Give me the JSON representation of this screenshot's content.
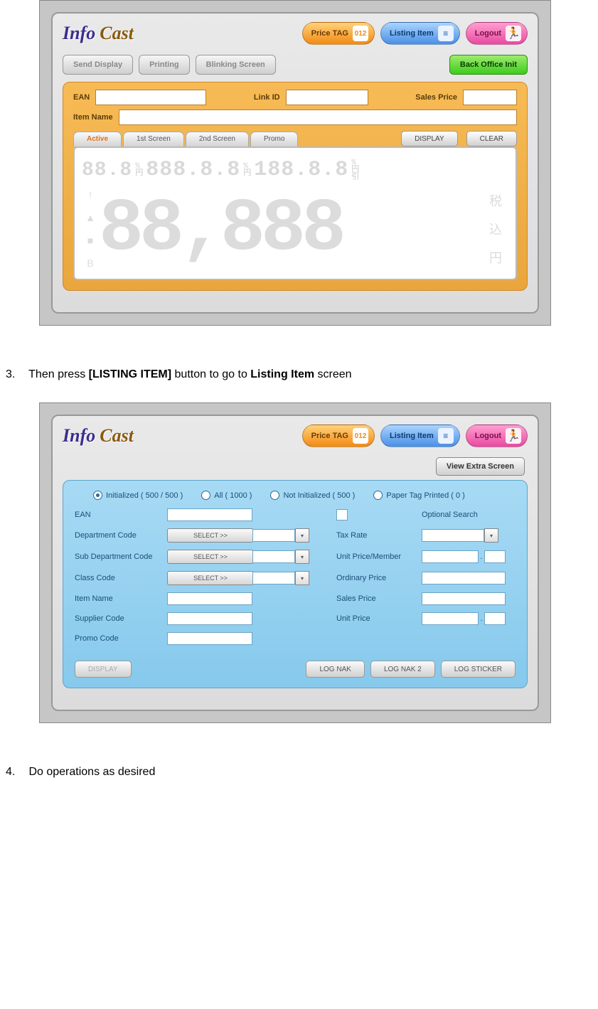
{
  "logo": {
    "part1": "Info",
    "part2": "Cast"
  },
  "nav": {
    "price_tag": "Price TAG",
    "price_tag_num": "012",
    "listing_item": "Listing Item",
    "logout": "Logout"
  },
  "screen1": {
    "toolbar": {
      "send_display": "Send Display",
      "printing": "Printing",
      "blinking": "Blinking Screen",
      "back_office": "Back Office Init"
    },
    "fields": {
      "ean": "EAN",
      "link_id": "Link ID",
      "sales_price": "Sales Price",
      "item_name": "Item Name"
    },
    "tabs": {
      "active": "Active",
      "first": "1st Screen",
      "second": "2nd Screen",
      "promo": "Promo"
    },
    "buttons": {
      "display": "DISPLAY",
      "clear": "CLEAR"
    },
    "lcd": {
      "top_left": "88.8",
      "top_mid": "888.8.8",
      "top_right": "188.8.8",
      "pct": "%",
      "yen": "円",
      "hiki": "引",
      "main_digits": "88,888",
      "side": {
        "ex": "!",
        "tri": "▲",
        "sq": "■",
        "b": "B"
      },
      "right": {
        "zei": "税",
        "komi": "込",
        "en": "円"
      }
    }
  },
  "instructions": {
    "step3_num": "3.",
    "step3_a": "Then press ",
    "step3_b": "[LISTING ITEM]",
    "step3_c": " button to go to ",
    "step3_d": "Listing Item",
    "step3_e": " screen",
    "step4_num": "4.",
    "step4_a": "Do operations as desired"
  },
  "screen2": {
    "view_extra": "View Extra Screen",
    "radios": {
      "initialized": "Initialized  ( 500 / 500 )",
      "all": "All  ( 1000 )",
      "not_init": "Not Initialized  ( 500 )",
      "paper_tag": "Paper Tag Printed  ( 0 )"
    },
    "labels": {
      "ean": "EAN",
      "optional": "Optional Search",
      "dept": "Department Code",
      "select": "SELECT >>",
      "tax": "Tax Rate",
      "subdept": "Sub Department Code",
      "unit_member": "Unit Price/Member",
      "class": "Class Code",
      "ordinary": "Ordinary Price",
      "item_name": "Item Name",
      "sales_price": "Sales Price",
      "supplier": "Supplier Code",
      "unit_price": "Unit Price",
      "promo": "Promo Code",
      "period": "."
    },
    "footer": {
      "display": "DISPLAY",
      "log_nak": "LOG NAK",
      "log_nak2": "LOG NAK 2",
      "log_sticker": "LOG STICKER"
    }
  }
}
